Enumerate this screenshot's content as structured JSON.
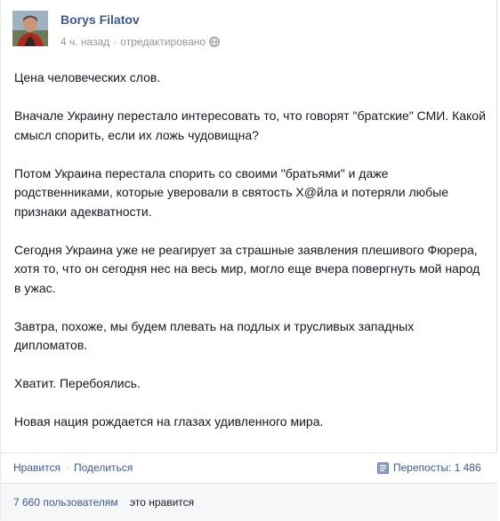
{
  "post": {
    "author": "Borys Filatov",
    "time": "4 ч. назад",
    "separator": "·",
    "edited": "отредактировано",
    "privacy_icon": "globe-icon",
    "paragraphs": [
      "Цена человеческих слов.",
      "Вначале Украину перестало интересовать то, что говорят \"братские\" СМИ. Какой смысл спорить, если их ложь чудовищна?",
      "Потом Украина перестала спорить со своими \"братьями\" и даже родственниками, которые уверовали в святость Х@йла и потеряли любые признаки адекватности.",
      "Сегодня Украина уже не реагирует за страшные заявления плешивого Фюрера, хотя то, что он сегодня нес на весь мир, могло еще вчера повергнуть мой народ в ужас.",
      "Завтра, похоже, мы будем плевать на подлых и трусливых западных дипломатов.",
      "Хватит. Перебоялись.",
      "Новая нация рождается на глазах удивленного мира."
    ]
  },
  "actions": {
    "like": "Нравится",
    "dot": "·",
    "share": "Поделиться",
    "reposts_icon": "reposts-icon",
    "reposts": "Перепосты: 1 486"
  },
  "likes": {
    "link": "7 660 пользователям",
    "tail": "это нравится"
  },
  "colors": {
    "link": "#3b5998",
    "meta": "#90949c",
    "text": "#141823",
    "likes_bg": "#f6f7f9"
  }
}
